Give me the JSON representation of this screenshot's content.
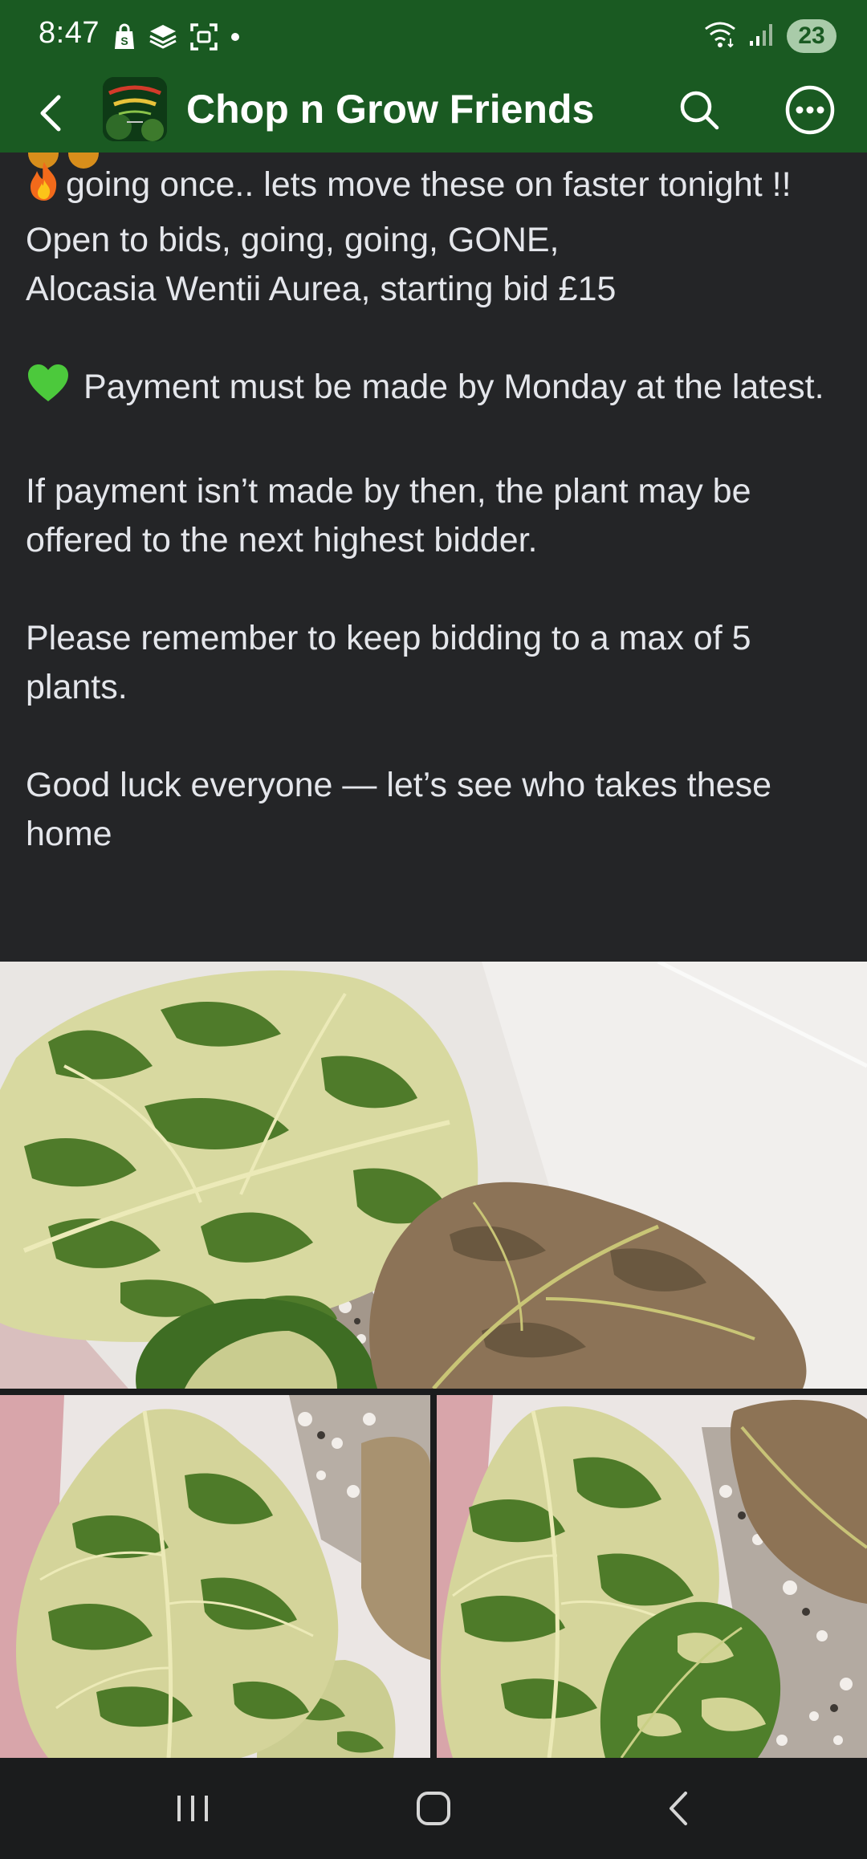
{
  "status_bar": {
    "time": "8:47",
    "battery_level": "23",
    "left_icons": [
      "shopping-bag-icon",
      "layers-icon",
      "screenshot-icon",
      "dot-icon"
    ],
    "right_icons": [
      "wifi-icon",
      "signal-icon",
      "battery-icon"
    ]
  },
  "header": {
    "title": "Chop n Grow Friends",
    "avatar_text": "Chop N Grow Friends",
    "colors": {
      "background": "#1a5a22",
      "text": "#ffffff"
    }
  },
  "post": {
    "cut_line_emojis": [
      "fire",
      "fire"
    ],
    "lines": [
      {
        "emoji": "fire",
        "text": "going once.. lets move these on faster tonight !!"
      },
      {
        "text": "Open to bids, going, going, GONE,"
      },
      {
        "text": "Alocasia Wentii Aurea, starting bid £15"
      },
      {
        "emoji": "green-heart",
        "text": "Payment must be made by Monday at the latest."
      },
      {
        "text": "If payment isn’t made by then, the plant may be offered to the next highest bidder."
      },
      {
        "text": "Please remember to keep bidding to a max of 5 plants."
      },
      {
        "text": "Good luck everyone — let’s see who takes these home"
      }
    ],
    "colors": {
      "background": "#242527",
      "text": "#e4e6eb"
    }
  },
  "photos": [
    {
      "name": "main-photo",
      "subject": "variegated alocasia leaves"
    },
    {
      "name": "left-photo",
      "subject": "variegated alocasia leaf"
    },
    {
      "name": "right-photo",
      "subject": "variegated alocasia leaves"
    }
  ],
  "nav_bar": {
    "buttons": [
      "recent-apps-icon",
      "home-icon",
      "back-icon"
    ]
  }
}
